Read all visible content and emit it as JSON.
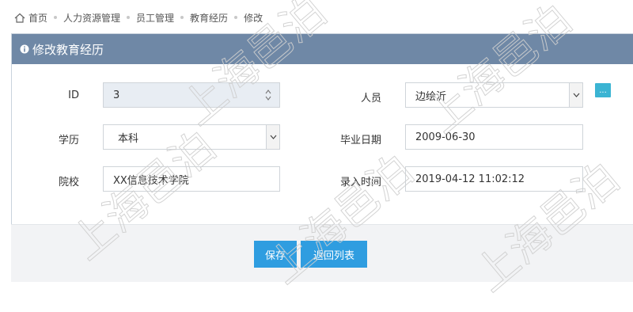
{
  "breadcrumb": [
    "首页",
    "人力资源管理",
    "员工管理",
    "教育经历",
    "修改"
  ],
  "panel": {
    "title": "修改教育经历"
  },
  "form": {
    "id": {
      "label": "ID",
      "value": "3"
    },
    "person": {
      "label": "人员",
      "value": "边绘沂",
      "more_label": "..."
    },
    "education": {
      "label": "学历",
      "value": "本科"
    },
    "graduation_date": {
      "label": "毕业日期",
      "value": "2009-06-30"
    },
    "school": {
      "label": "院校",
      "value": "XX信息技术学院"
    },
    "entry_time": {
      "label": "录入时间",
      "value": "2019-04-12 11:02:12"
    }
  },
  "actions": {
    "save_label": "保存",
    "back_label": "返回列表"
  },
  "watermark_text": "上海邑泊",
  "colors": {
    "header": "#6f88a6",
    "button": "#2f9de0",
    "more_button": "#3bb4d3",
    "readonly_bg": "#e8edf3"
  },
  "icons": [
    "home-icon",
    "info-icon",
    "spinner-icon",
    "chevron-down-icon"
  ]
}
